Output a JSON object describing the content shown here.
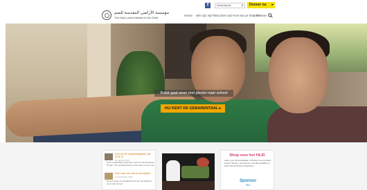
{
  "utility": {
    "language": "Nederlands",
    "donate_label": "Doneer nu"
  },
  "header": {
    "logo_arabic": "مؤسسة الأراضي المقدسة للصم",
    "logo_english": "The Holy Land Institute for the Deaf",
    "nav": [
      {
        "label": "Home"
      },
      {
        "label": "Wie zijn wij?"
      },
      {
        "label": "Wat doen wij?"
      },
      {
        "label": "Hoe kun je helpen?"
      },
      {
        "label": "Nieuws"
      }
    ]
  },
  "hero": {
    "caption": "Rafat gaat weer met plezier naar school",
    "cta_label": "HIJ KENT DE GEBARENTAAL"
  },
  "news": {
    "items": [
      {
        "title": "Kom op de verjaardagsparty van HLID in",
        "date": "26 oktober 2021",
        "text": "Deze verjaardag is bijzonder want het HLID bestaat 50 jaar. Kom gezellig langs op het feest en doe mee."
      },
      {
        "title": "Kom naar een nieuw schooljaar!",
        "date": "17 september 2021",
        "text": "Na een lange zomervakantie kunnen de kinderen weer naar school."
      }
    ]
  },
  "shop": {
    "title": "Shop voor het HLID",
    "text": "Laat u een extra bedragen of bestelt u een product online? Wordt u ook sponsor van Sponsorkliks en steun het HLID bij uw aankopen.",
    "sponsor_word": "Sponsor",
    "sponsor_sub": "Kliks"
  },
  "colors": {
    "donate": "#f6e100",
    "cta": "#f0a800",
    "shop_title": "#d23b7a",
    "news_title": "#d07800",
    "facebook": "#3b5998"
  }
}
